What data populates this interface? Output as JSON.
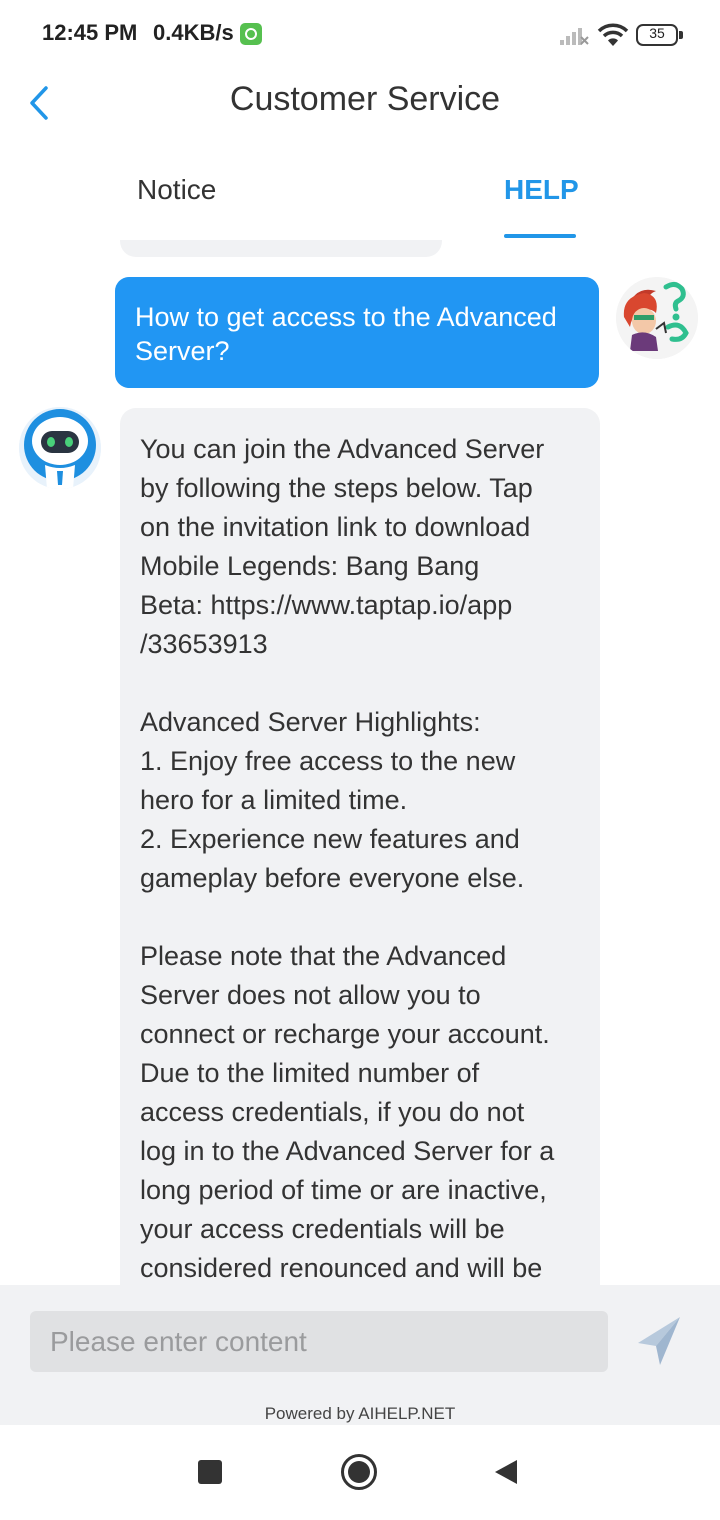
{
  "status_bar": {
    "time": "12:45 PM",
    "speed": "0.4KB/s",
    "battery": "35",
    "icons": [
      "app-notification-icon",
      "signal-icon",
      "wifi-icon",
      "battery-icon"
    ]
  },
  "header": {
    "title": "Customer Service",
    "back_icon": "chevron-left-icon"
  },
  "tabs": [
    {
      "label": "Notice",
      "active": false
    },
    {
      "label": "HELP",
      "active": true
    }
  ],
  "chat": {
    "user_message": {
      "lines": [
        "How to get access to the Advanced",
        "Server?"
      ]
    },
    "bot_message": {
      "paragraphs": [
        [
          "You can join the Advanced Server",
          "by following the steps below. Tap",
          "on the invitation link to download",
          "Mobile Legends: Bang Bang",
          "Beta: https://www.taptap.io/app",
          "/33653913"
        ],
        [
          "Advanced Server Highlights:",
          "1. Enjoy free access to the new",
          "hero for a limited time.",
          "2. Experience new features and",
          "gameplay before everyone else."
        ],
        [
          "Please note that the Advanced",
          "Server does not allow you to",
          "connect or recharge your account.",
          "Due to the limited number of",
          "access credentials, if you do not",
          "log in to the Advanced Server for a",
          "long period of time or are inactive,",
          "your access credentials will be",
          "considered renounced and will be"
        ]
      ]
    }
  },
  "input": {
    "placeholder": "Please enter content",
    "value": "",
    "send_icon": "send-icon"
  },
  "powered_by": "Powered by AIHELP.NET",
  "colors": {
    "accent": "#2196f3",
    "bubble_gray": "#f1f2f4",
    "input_bg": "#e0e1e3"
  }
}
